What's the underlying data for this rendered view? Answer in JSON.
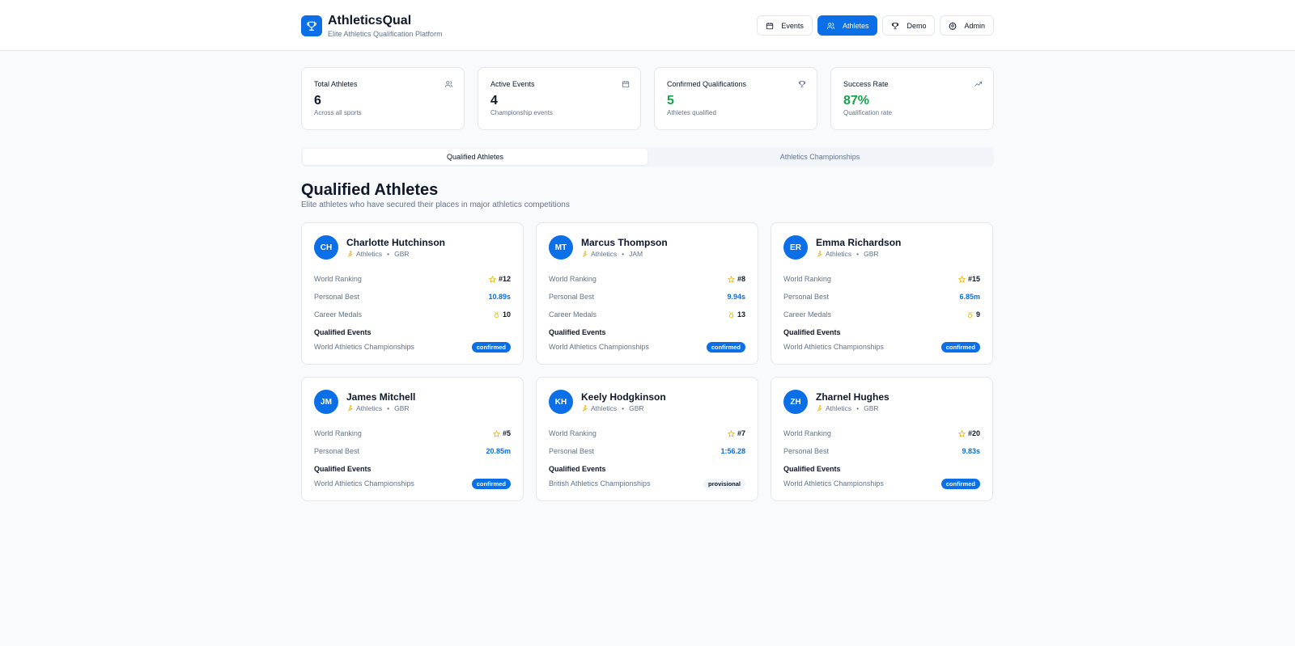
{
  "brand": {
    "title": "AthleticsQual",
    "subtitle": "Elite Athletics Qualification Platform",
    "logo_icon": "trophy-icon"
  },
  "nav": [
    {
      "label": "Events",
      "icon": "calendar-icon",
      "active": false
    },
    {
      "label": "Athletes",
      "icon": "users-icon",
      "active": true
    },
    {
      "label": "Demo",
      "icon": "trophy-icon",
      "active": false
    },
    {
      "label": "Admin",
      "icon": "gear-icon",
      "active": false
    }
  ],
  "stats": [
    {
      "label": "Total Athletes",
      "value": "6",
      "note": "Across all sports",
      "icon": "users-icon"
    },
    {
      "label": "Active Events",
      "value": "4",
      "note": "Championship events",
      "icon": "calendar-icon"
    },
    {
      "label": "Confirmed Qualifications",
      "value": "5",
      "note": "Athletes qualified",
      "icon": "trophy-icon"
    },
    {
      "label": "Success Rate",
      "value": "87%",
      "note": "Qualification rate",
      "icon": "trending-up-icon"
    }
  ],
  "tabs": [
    {
      "label": "Qualified Athletes",
      "active": true
    },
    {
      "label": "Athletics Championships",
      "active": false
    }
  ],
  "section": {
    "title": "Qualified Athletes",
    "subtitle": "Elite athletes who have secured their places in major athletics competitions"
  },
  "labels": {
    "world_ranking": "World Ranking",
    "personal_best": "Personal Best",
    "career_medals": "Career Medals",
    "qualified_events": "Qualified Events"
  },
  "athletes": [
    {
      "initials": "CH",
      "name": "Charlotte Hutchinson",
      "sport": "Athletics",
      "country": "GBR",
      "ranking": "#12",
      "pb": "10.89s",
      "medals": "10",
      "event": "World Athletics Championships",
      "status": "confirmed"
    },
    {
      "initials": "MT",
      "name": "Marcus Thompson",
      "sport": "Athletics",
      "country": "JAM",
      "ranking": "#8",
      "pb": "9.94s",
      "medals": "13",
      "event": "World Athletics Championships",
      "status": "confirmed"
    },
    {
      "initials": "ER",
      "name": "Emma Richardson",
      "sport": "Athletics",
      "country": "GBR",
      "ranking": "#15",
      "pb": "6.85m",
      "medals": "9",
      "event": "World Athletics Championships",
      "status": "confirmed"
    },
    {
      "initials": "JM",
      "name": "James Mitchell",
      "sport": "Athletics",
      "country": "GBR",
      "ranking": "#5",
      "pb": "20.85m",
      "medals": null,
      "event": "World Athletics Championships",
      "status": "confirmed"
    },
    {
      "initials": "KH",
      "name": "Keely Hodgkinson",
      "sport": "Athletics",
      "country": "GBR",
      "ranking": "#7",
      "pb": "1:56.28",
      "medals": null,
      "event": "British Athletics Championships",
      "status": "provisional"
    },
    {
      "initials": "ZH",
      "name": "Zharnel Hughes",
      "sport": "Athletics",
      "country": "GBR",
      "ranking": "#20",
      "pb": "9.83s",
      "medals": null,
      "event": "World Athletics Championships",
      "status": "confirmed"
    }
  ],
  "colors": {
    "accent": "#0b6fe8",
    "success": "#16a34a",
    "star": "#eab308"
  }
}
